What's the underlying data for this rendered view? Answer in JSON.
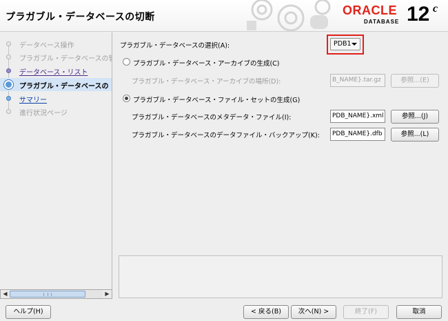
{
  "header": {
    "title": "プラガブル・データベースの切断",
    "logo_brand": "ORACLE",
    "logo_product": "DATABASE",
    "logo_version": "12",
    "logo_version_suffix": "c"
  },
  "nav": {
    "steps": [
      {
        "label": "データベース操作",
        "state": "dim"
      },
      {
        "label": "プラガブル・データベースの管",
        "state": "dim"
      },
      {
        "label": "データベース・リスト",
        "state": "done"
      },
      {
        "label": "プラガブル・データベースの",
        "state": "current"
      },
      {
        "label": "サマリー",
        "state": "link"
      },
      {
        "label": "進行状況ページ",
        "state": "dim"
      }
    ]
  },
  "form": {
    "pdb_select_label": "プラガブル・データベースの選択(A):",
    "pdb_selected": "PDB1",
    "archive_radio_label": "プラガブル・データベース・アーカイブの生成(C)",
    "archive_location_label": "プラガブル・データベース・アーカイブの場所(D):",
    "archive_location_value": "B_NAME}.tar.gz",
    "browse_e": "参照...(E)",
    "fileset_radio_label": "プラガブル・データベース・ファイル・セットの生成(G)",
    "metadata_label": "プラガブル・データベースのメタデータ・ファイル(I):",
    "metadata_value": "PDB_NAME}.xml",
    "browse_j": "参照...(J)",
    "datafile_backup_label": "プラガブル・データベースのデータファイル・バックアップ(K):",
    "datafile_backup_value": "PDB_NAME}.dfb",
    "browse_l": "参照...(L)"
  },
  "footer": {
    "help": "ヘルプ(H)",
    "back": "< 戻る(B)",
    "next": "次へ(N) >",
    "finish": "終了(F)",
    "cancel": "取消"
  }
}
